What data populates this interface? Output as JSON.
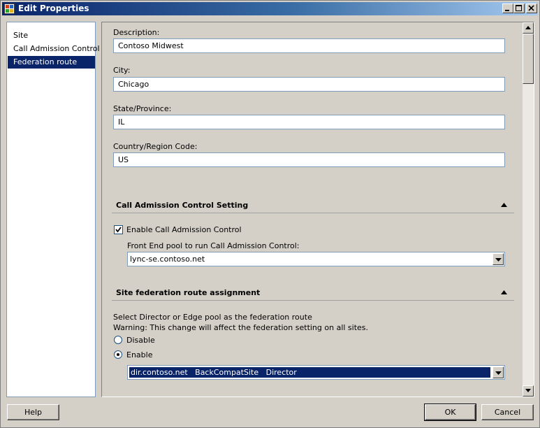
{
  "window": {
    "title": "Edit Properties"
  },
  "nav": {
    "items": [
      {
        "label": "Site"
      },
      {
        "label": "Call Admission Control"
      },
      {
        "label": "Federation route"
      }
    ]
  },
  "form": {
    "description": {
      "label": "Description:",
      "value": "Contoso Midwest"
    },
    "city": {
      "label": "City:",
      "value": "Chicago"
    },
    "state": {
      "label": "State/Province:",
      "value": "IL"
    },
    "country": {
      "label": "Country/Region Code:",
      "value": "US"
    }
  },
  "cac_section": {
    "title": "Call Admission Control Setting",
    "enable_label": "Enable Call Admission Control",
    "enabled": true,
    "pool_label": "Front End pool to run Call Admission Control:",
    "pool_value": "lync-se.contoso.net"
  },
  "fed_section": {
    "title": "Site federation route assignment",
    "instruction": "Select Director or Edge pool as the federation route",
    "warning": "Warning: This change will affect the federation setting on all sites.",
    "disable_label": "Disable",
    "enable_label": "Enable",
    "selected_option": "Enable",
    "route_value": "dir.contoso.net   BackCompatSite   Director"
  },
  "buttons": {
    "help": "Help",
    "ok": "OK",
    "cancel": "Cancel"
  },
  "colors": {
    "selection": "#0a246a",
    "title_start": "#0a246a",
    "title_end": "#a6caf0"
  }
}
